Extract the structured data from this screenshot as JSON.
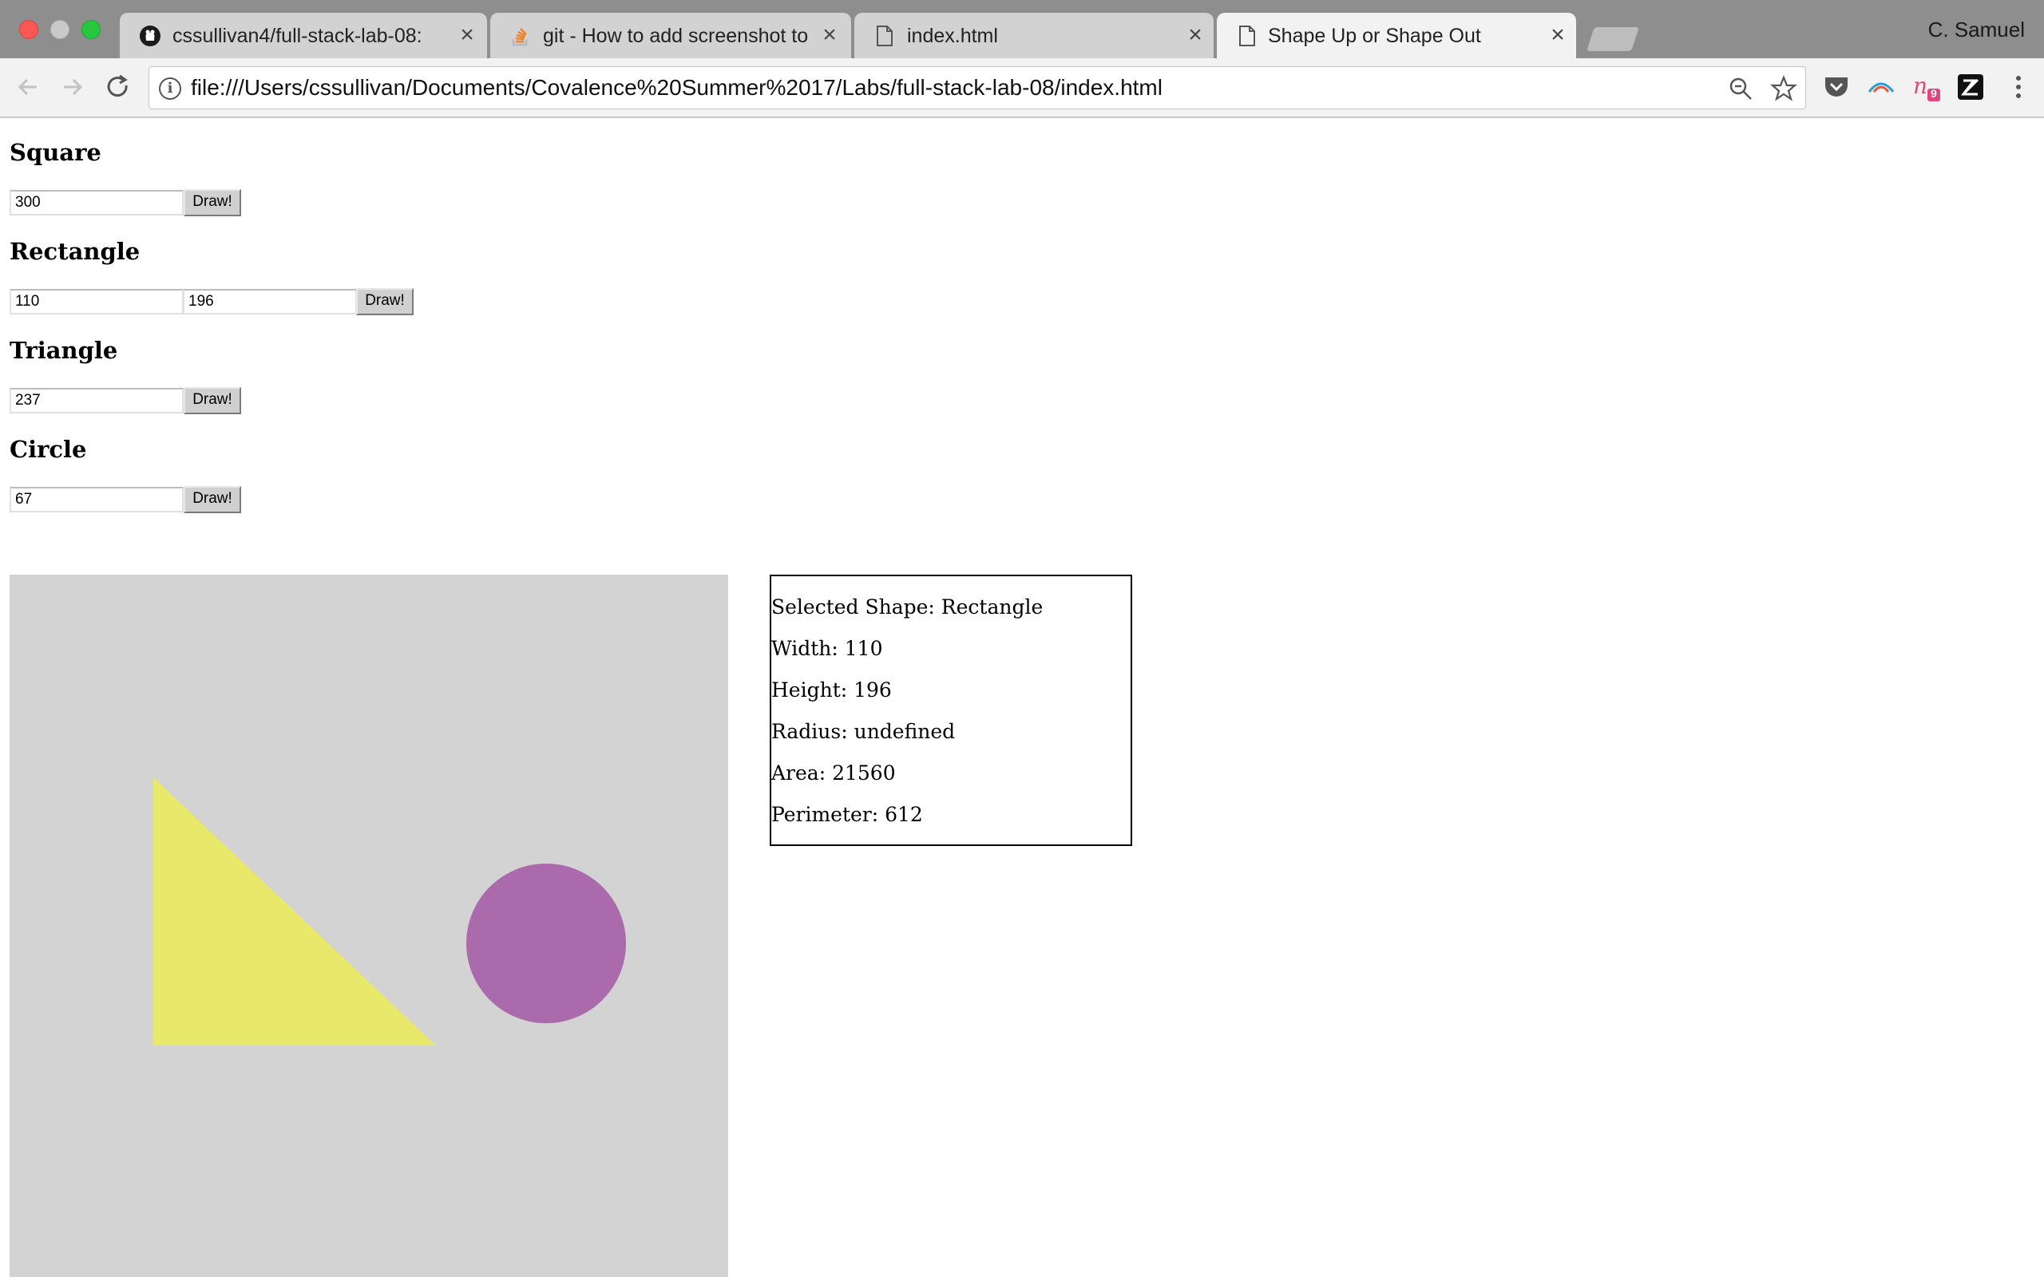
{
  "browser": {
    "tabs": [
      {
        "title": "cssullivan4/full-stack-lab-08: ",
        "icon": "github-icon",
        "active": false
      },
      {
        "title": "git - How to add screenshot to",
        "icon": "stackoverflow-icon",
        "active": false
      },
      {
        "title": "index.html",
        "icon": "file-icon",
        "active": false
      },
      {
        "title": "Shape Up or Shape Out",
        "icon": "file-icon",
        "active": true
      }
    ],
    "profile_name": "C. Samuel",
    "address_url": "file:///Users/cssullivan/Documents/Covalence%20Summer%2017/Labs/full-stack-lab-08/index.html",
    "extensions": [
      "pocket-icon",
      "arc-icon",
      "notes-icon",
      "zendesk-icon"
    ],
    "extension_badge": "9"
  },
  "page": {
    "square": {
      "heading": "Square",
      "input_value": "300",
      "button_label": "Draw!"
    },
    "rectangle": {
      "heading": "Rectangle",
      "width_value": "110",
      "height_value": "196",
      "button_label": "Draw!"
    },
    "triangle": {
      "heading": "Triangle",
      "input_value": "237",
      "button_label": "Draw!"
    },
    "circle": {
      "heading": "Circle",
      "input_value": "67",
      "button_label": "Draw!"
    },
    "info": {
      "selected": "Selected Shape: Rectangle",
      "width": "Width: 110",
      "height": "Height: 196",
      "radius": "Radius: undefined",
      "area": "Area: 21560",
      "perimeter": "Perimeter: 612"
    },
    "shapes": {
      "triangle_color": "#e8e86a",
      "circle_color": "#ab6aab",
      "canvas_color": "#d3d3d3"
    }
  }
}
